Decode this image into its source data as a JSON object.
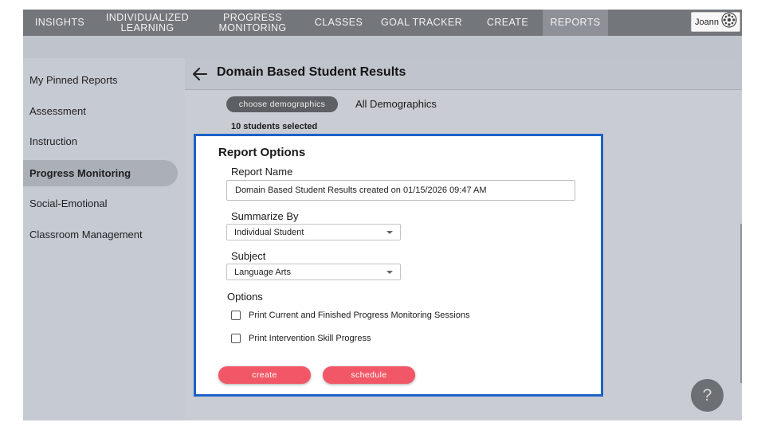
{
  "nav": {
    "items": [
      {
        "label": "INSIGHTS",
        "active": false
      },
      {
        "label": "INDIVIDUALIZED\nLEARNING",
        "active": false
      },
      {
        "label": "PROGRESS\nMONITORING",
        "active": false
      },
      {
        "label": "CLASSES",
        "active": false
      },
      {
        "label": "GOAL TRACKER",
        "active": false
      },
      {
        "label": "CREATE",
        "active": false
      },
      {
        "label": "REPORTS",
        "active": true
      }
    ],
    "user_name": "Joann",
    "avatar_icon": "avatar-pattern-icon"
  },
  "sidebar": {
    "items": [
      {
        "label": "My Pinned Reports",
        "active": false
      },
      {
        "label": "Assessment",
        "active": false
      },
      {
        "label": "Instruction",
        "active": false
      },
      {
        "label": "Progress Monitoring",
        "active": true
      },
      {
        "label": "Social-Emotional",
        "active": false
      },
      {
        "label": "Classroom Management",
        "active": false
      }
    ]
  },
  "header": {
    "back_icon": "arrow-left-icon",
    "title": "Domain Based Student Results"
  },
  "demographics": {
    "button_label": "choose demographics",
    "value": "All Demographics",
    "selected_count": "10 students selected"
  },
  "report_options": {
    "title": "Report Options",
    "report_name_label": "Report Name",
    "report_name_value": "Domain Based Student Results created on 01/15/2026 09:47 AM",
    "summarize_label": "Summarize By",
    "summarize_value": "Individual Student",
    "subject_label": "Subject",
    "subject_value": "Language Arts",
    "options_label": "Options",
    "options": [
      {
        "label": "Print Current and Finished Progress Monitoring Sessions",
        "checked": false
      },
      {
        "label": "Print Intervention Skill Progress",
        "checked": false
      }
    ],
    "create_label": "create",
    "schedule_label": "schedule"
  },
  "help": {
    "label": "?"
  },
  "colors": {
    "nav_bg": "#73767b",
    "accent_button": "#f15767",
    "card_border": "#1d62c7"
  }
}
